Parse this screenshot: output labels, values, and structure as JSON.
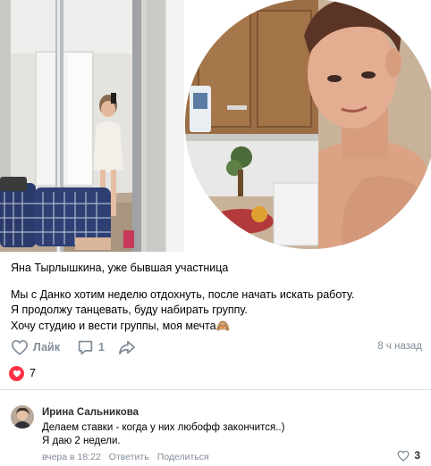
{
  "post": {
    "lines": [
      "Яна Тырлышкина, уже бывшая участница",
      "Мы с Данко хотим неделю отдохнуть, после начать искать работу.",
      "Я продолжу танцевать, буду набирать группу.",
      "Хочу студию и вести группы, моя мечта🙈"
    ],
    "time_ago": "8 ч назад"
  },
  "actions": {
    "like_label": "Лайк",
    "comment_count": "1",
    "like_icon": "heart-outline-icon",
    "comment_icon": "speech-bubble-icon",
    "share_icon": "share-arrow-icon"
  },
  "reactions": {
    "icon": "heart-filled-icon",
    "count": "7"
  },
  "comment": {
    "author": "Ирина Сальникова",
    "text_lines": [
      "Делаем ставки - когда у них любофф закончится..)",
      "Я даю 2 недели."
    ],
    "time": "вчера в 18:22",
    "reply_label": "Ответить",
    "share_label": "Поделиться",
    "like_count": "3"
  },
  "colors": {
    "muted": "#818c99",
    "heart_red": "#ff3347",
    "divider": "#dce1e6"
  }
}
